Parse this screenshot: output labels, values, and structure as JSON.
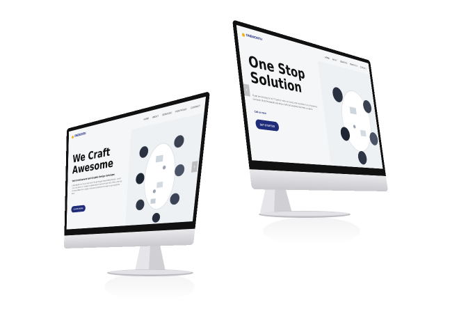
{
  "monitors": [
    {
      "nav": {
        "logo_text": "ONEMONTH",
        "menu": [
          "HOME",
          "ABOUT",
          "SERVICES",
          "PORTFOLIO",
          "CONTACT"
        ]
      },
      "hero": {
        "title": "We Craft\nAwesome",
        "subtitle": "Web Development and Graphic Design Solutions",
        "body": "Lorem ipsum is simply dummy text of the printing and typesetting industry. Lorem ipsum has been the industry's standard dummy text ever since the 1500s, when an unknown printer took a galley of type and scrambled it to make a type specimen book.",
        "cta_label": "LEARN MORE"
      }
    },
    {
      "nav": {
        "logo_text": "ONEMONTH",
        "menu": [
          "HOME",
          "ABOUT",
          "SERVICES",
          "PORTFOLIO",
          "CONTACT"
        ]
      },
      "hero": {
        "title": "One Stop\nSolution",
        "body": "If you are looking for an IT partner who can bring real expertise to your business, our team of professionals will deliver tailored solutions that help you grow.",
        "link_text": "Call us now",
        "cta_label": "GET STARTED"
      }
    }
  ],
  "colors": {
    "brand_navy": "#1e2c7a",
    "logo_accent": "#f2b01e",
    "bezel": "#111111",
    "aluminum": "#d3d3d8"
  }
}
